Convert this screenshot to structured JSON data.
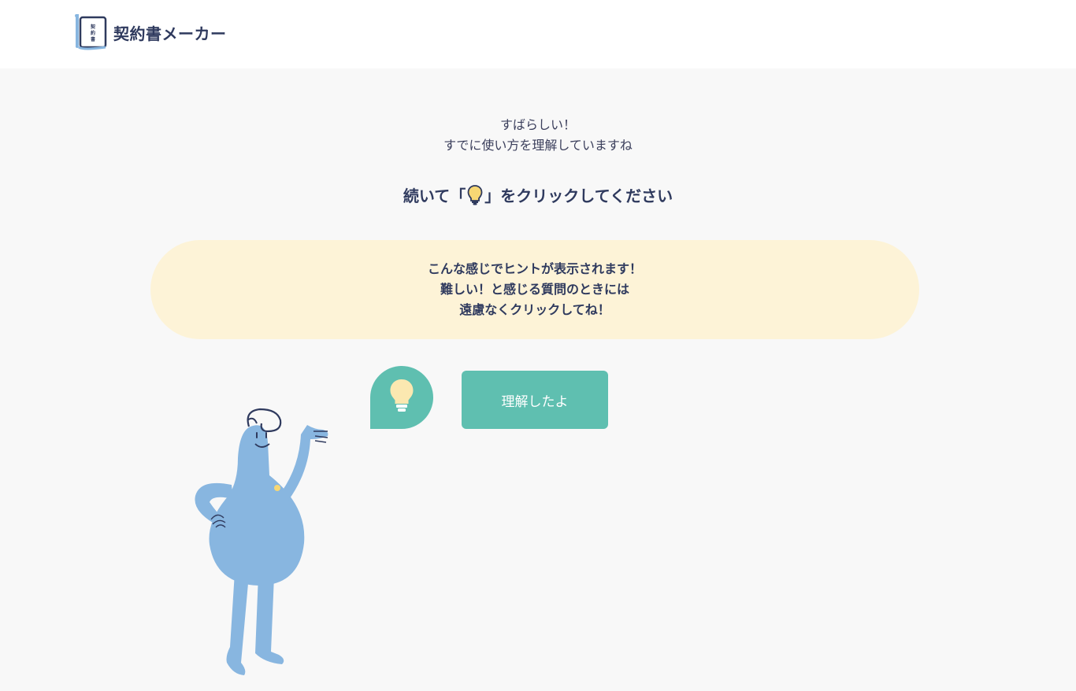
{
  "header": {
    "logo_text": "契約書メーカー",
    "logo_icon_text": "契約書",
    "logo_icon": "contract-book-icon"
  },
  "intro": {
    "line1": "すばらしい！",
    "line2": "すでに使い方を理解していますね"
  },
  "instruction": {
    "prefix": "続いて「",
    "icon": "lightbulb-icon",
    "suffix": "」をクリックしてください"
  },
  "hint_box": {
    "line1": "こんな感じでヒントが表示されます！",
    "line2": "難しい！と感じる質問のときには",
    "line3": "遠慮なくクリックしてね！"
  },
  "hint_button": {
    "icon": "lightbulb-icon"
  },
  "understood_button": {
    "label": "理解したよ"
  },
  "colors": {
    "accent": "#5fbfb0",
    "hint_bg": "#fdf3d7",
    "text": "#2f3a5e",
    "bulb": "#f7d774",
    "mascot": "#88b6e0"
  }
}
